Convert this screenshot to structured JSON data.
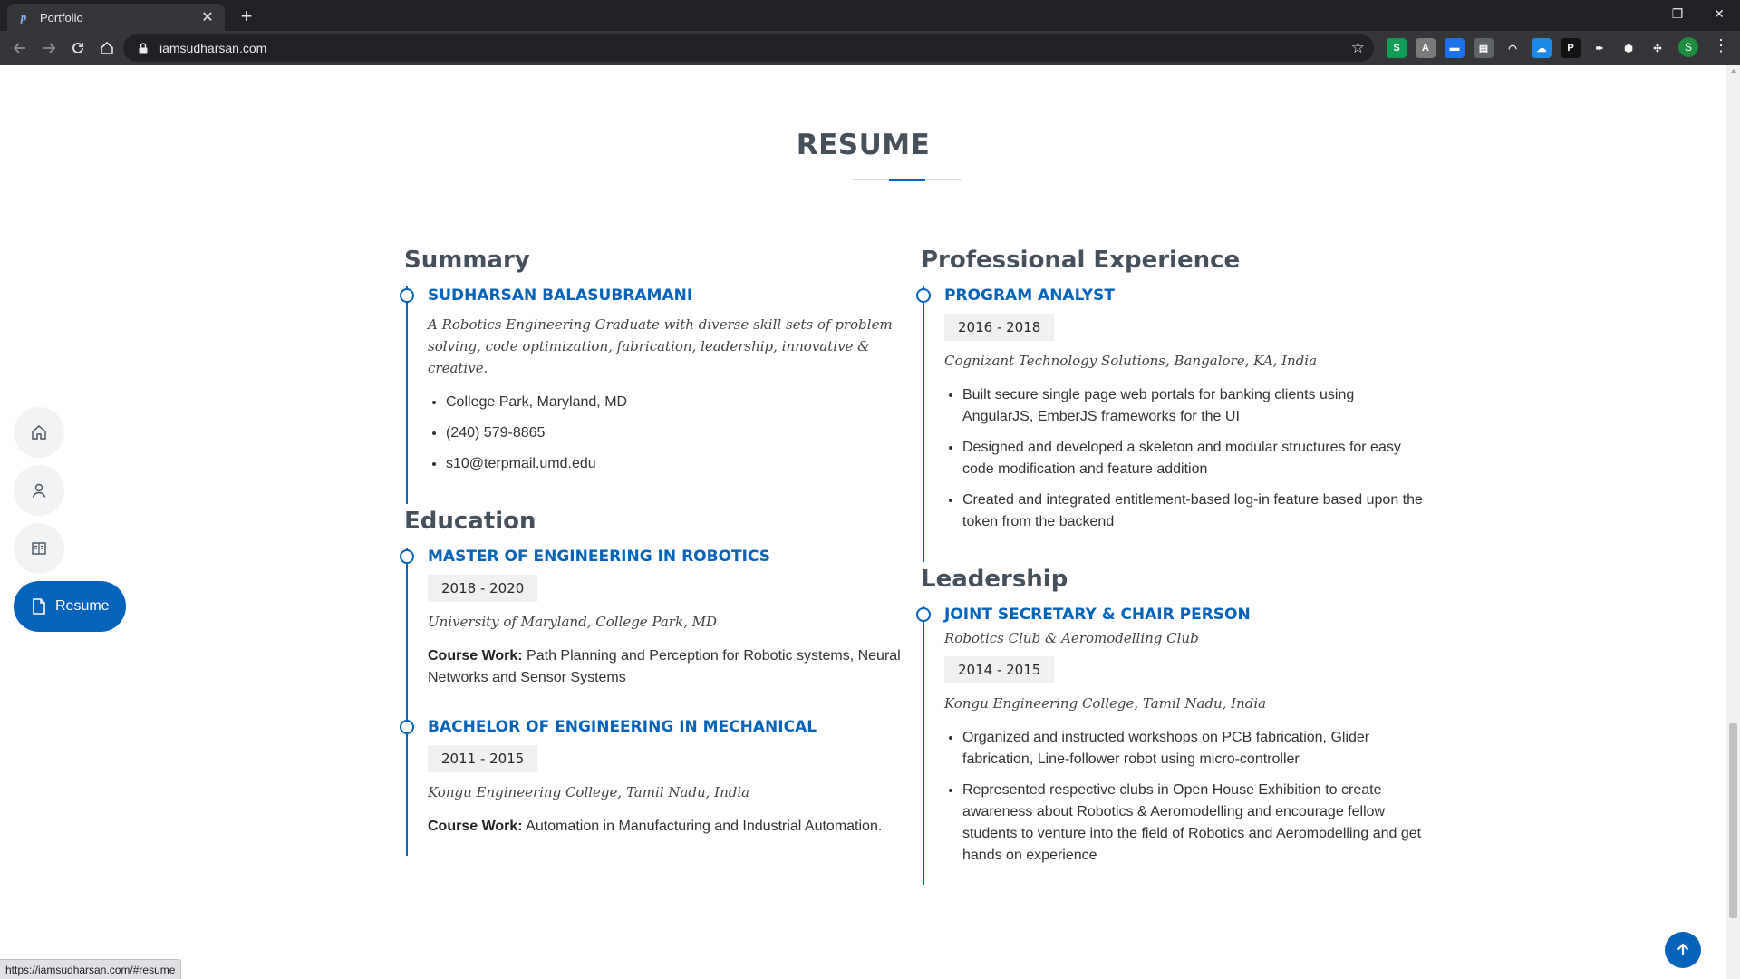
{
  "browser": {
    "tab_title": "Portfolio",
    "url": "iamsudharsan.com",
    "status_url": "https://iamsudharsan.com/#resume",
    "profile_initial": "S",
    "extensions": [
      {
        "name": "stylus-ext-icon",
        "color": "#0f9d58",
        "glyph": "S"
      },
      {
        "name": "screenshot-ext-icon",
        "color": "#7a7a7a",
        "glyph": "A"
      },
      {
        "name": "calendar-ext-icon",
        "color": "#1a73e8",
        "glyph": "▬"
      },
      {
        "name": "print-ext-icon",
        "color": "#5f6368",
        "glyph": "▤"
      },
      {
        "name": "arc-ext-icon",
        "color": "#35363a",
        "glyph": "◠"
      },
      {
        "name": "cloud-ext-icon",
        "color": "#1e88e5",
        "glyph": "☁"
      },
      {
        "name": "pocket-ext-icon",
        "color": "#111111",
        "glyph": "P"
      },
      {
        "name": "feather-ext-icon",
        "color": "#35363a",
        "glyph": "✒"
      },
      {
        "name": "cube-ext-icon",
        "color": "#35363a",
        "glyph": "⬢"
      },
      {
        "name": "puzzle-ext-icon",
        "color": "#35363a",
        "glyph": "✣"
      }
    ]
  },
  "section": {
    "title": "RESUME"
  },
  "summary": {
    "heading": "Summary",
    "name": "SUDHARSAN BALASUBRAMANI",
    "tagline": "A Robotics Engineering Graduate with diverse skill sets of problem solving, code optimization, fabrication, leadership, innovative & creative.",
    "contacts": [
      "College Park, Maryland, MD",
      "(240) 579-8865",
      "s10@terpmail.umd.edu"
    ]
  },
  "education": {
    "heading": "Education",
    "items": [
      {
        "degree": "MASTER OF ENGINEERING IN ROBOTICS",
        "years": "2018 - 2020",
        "school": "University of Maryland, College Park, MD",
        "course_label": "Course Work:",
        "course": " Path Planning and Perception for Robotic systems, Neural Networks and Sensor Systems"
      },
      {
        "degree": "BACHELOR OF ENGINEERING IN MECHANICAL",
        "years": "2011 - 2015",
        "school": "Kongu Engineering College, Tamil Nadu, India",
        "course_label": "Course Work:",
        "course": " Automation in Manufacturing and Industrial Automation."
      }
    ]
  },
  "experience": {
    "heading": "Professional Experience",
    "items": [
      {
        "role": "PROGRAM ANALYST",
        "years": "2016 - 2018",
        "company": "Cognizant Technology Solutions, Bangalore, KA, India",
        "bullets": [
          "Built secure single page web portals for banking clients using AngularJS, EmberJS frameworks for the UI",
          "Designed and developed a skeleton and modular structures for easy code modification and feature addition",
          "Created and integrated entitlement-based log-in feature based upon the token from the backend"
        ]
      }
    ]
  },
  "leadership": {
    "heading": "Leadership",
    "items": [
      {
        "role": "JOINT SECRETARY & CHAIR PERSON",
        "org": "Robotics Club & Aeromodelling Club",
        "years": "2014 - 2015",
        "school": "Kongu Engineering College, Tamil Nadu, India",
        "bullets": [
          "Organized and instructed workshops on PCB fabrication, Glider fabrication, Line-follower robot using micro-controller",
          "Represented respective clubs in Open House Exhibition to create awareness about Robotics & Aeromodelling and encourage fellow students to venture into the field of Robotics and Aeromodelling and get hands on experience"
        ]
      }
    ]
  },
  "sidenav": {
    "active_label": "Resume"
  },
  "colors": {
    "accent": "#0563bb",
    "heading": "#45505b",
    "chrome_dark": "#202124",
    "chrome_toolbar": "#35363a"
  }
}
